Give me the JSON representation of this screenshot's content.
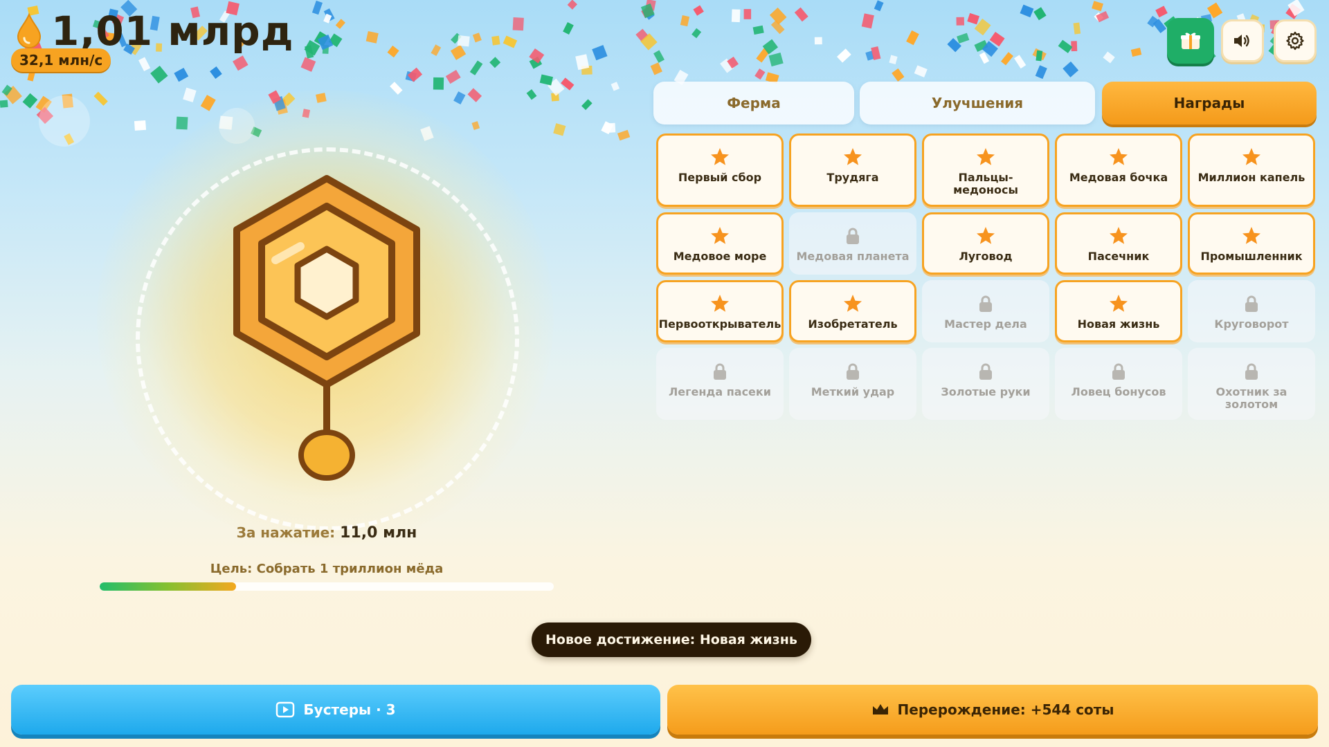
{
  "header": {
    "honey_total": "1,01 млрд",
    "honey_rate": "32,1 млн/с",
    "icons": [
      "honey-drop-icon",
      "gift-icon",
      "speaker-icon",
      "gear-icon"
    ]
  },
  "tabs": [
    {
      "label": "Ферма",
      "active": false
    },
    {
      "label": "Улучшения",
      "active": false
    },
    {
      "label": "Награды",
      "active": true
    }
  ],
  "achievements": [
    {
      "label": "Первый сбор",
      "earned": true
    },
    {
      "label": "Трудяга",
      "earned": true
    },
    {
      "label": "Пальцы-медоносы",
      "earned": true
    },
    {
      "label": "Медовая бочка",
      "earned": true
    },
    {
      "label": "Миллион капель",
      "earned": true
    },
    {
      "label": "Медовое море",
      "earned": true
    },
    {
      "label": "Медовая планета",
      "earned": false
    },
    {
      "label": "Луговод",
      "earned": true
    },
    {
      "label": "Пасечник",
      "earned": true
    },
    {
      "label": "Промышленник",
      "earned": true
    },
    {
      "label": "Первооткрыватель",
      "earned": true
    },
    {
      "label": "Изобретатель",
      "earned": true
    },
    {
      "label": "Мастер дела",
      "earned": false
    },
    {
      "label": "Новая жизнь",
      "earned": true
    },
    {
      "label": "Круговорот",
      "earned": false
    },
    {
      "label": "Легенда пасеки",
      "earned": false
    },
    {
      "label": "Меткий удар",
      "earned": false
    },
    {
      "label": "Золотые руки",
      "earned": false
    },
    {
      "label": "Ловец бонусов",
      "earned": false
    },
    {
      "label": "Охотник за золотом",
      "earned": false
    }
  ],
  "tap": {
    "label": "За нажатие:",
    "value": "11,0 млн"
  },
  "goal": {
    "text": "Цель: Собрать 1 триллион мёда",
    "progress": 0.3
  },
  "toast": {
    "text": "Новое достижение: Новая жизнь"
  },
  "bottom": {
    "boosters_label": "Бустеры · 3",
    "rebirth_label": "Перерождение: +544 соты"
  },
  "colors": {
    "accent": "#f7a321",
    "gift": "#1fae67",
    "boosters": "#2eb4f2",
    "toast_bg": "#2a1a06"
  }
}
